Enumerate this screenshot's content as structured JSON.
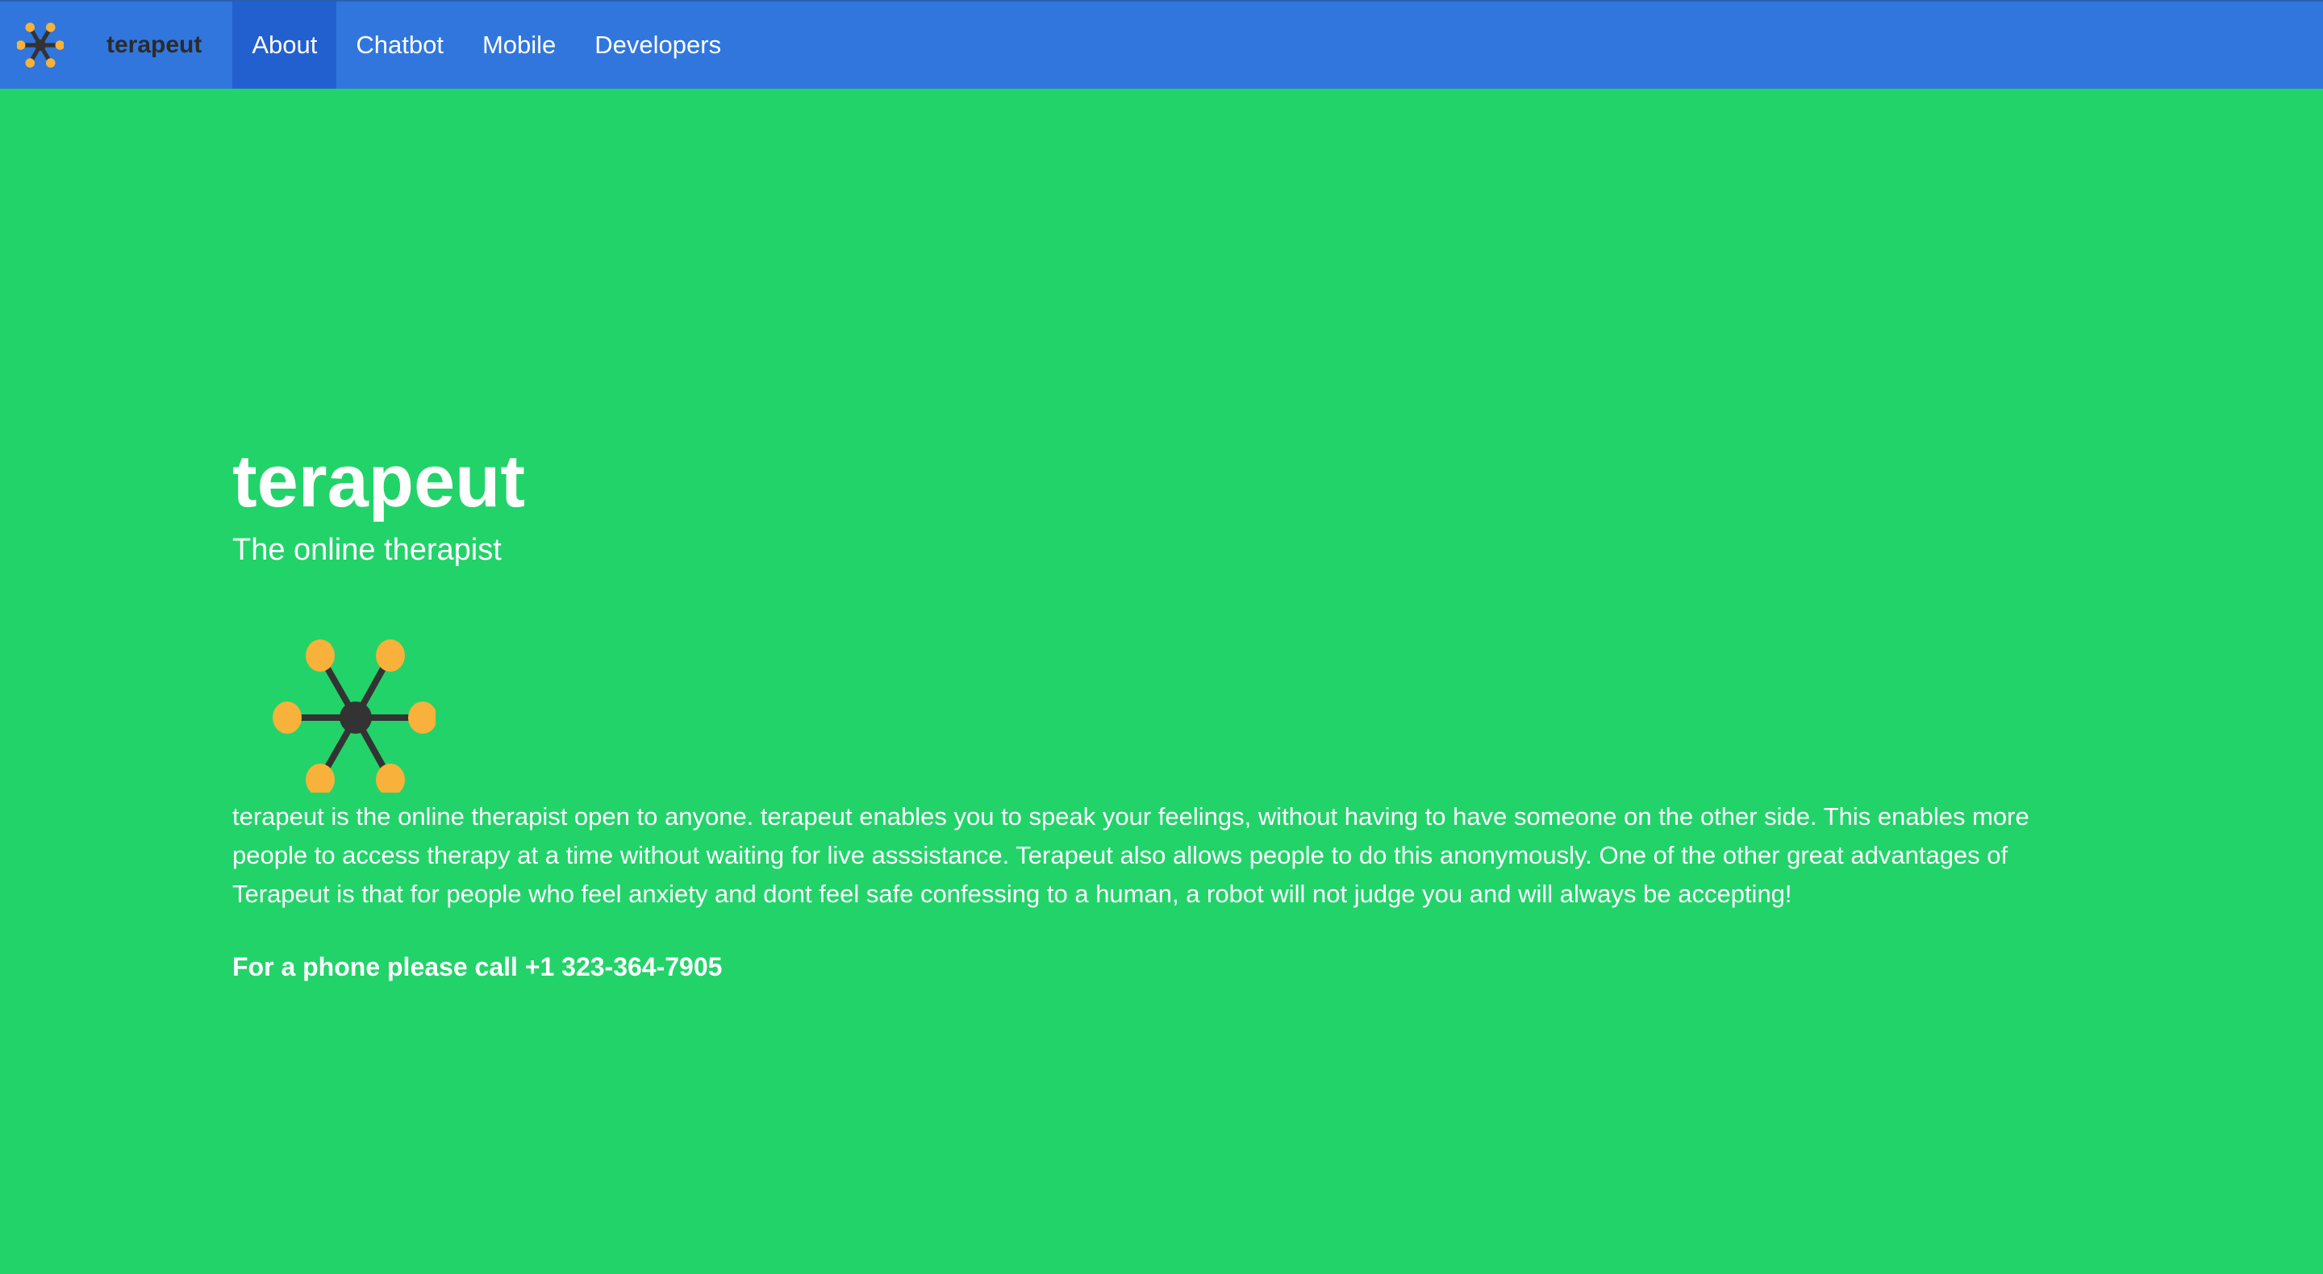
{
  "nav": {
    "brand": "terapeut",
    "items": [
      {
        "label": "About",
        "active": true
      },
      {
        "label": "Chatbot",
        "active": false
      },
      {
        "label": "Mobile",
        "active": false
      },
      {
        "label": "Developers",
        "active": false
      }
    ]
  },
  "hero": {
    "title": "terapeut",
    "subtitle": "The online therapist",
    "logo_icon": "network-node-icon",
    "description": "terapeut is the online therapist open to anyone. terapeut enables you to speak your feelings, without having to have someone on the other side. This enables more people to access therapy at a time without waiting for live asssistance. Terapeut also allows people to do this anonymously. One of the other great advantages of Terapeut is that for people who feel anxiety and dont feel safe confessing to a human, a robot will not judge you and will always be accepting!",
    "phone": "For a phone please call +1 323-364-7905"
  },
  "colors": {
    "background": "#22d36a",
    "navbar": "#3176dd",
    "nav_active": "#2360cf",
    "node": "#f8b13a",
    "hub": "#333333"
  }
}
